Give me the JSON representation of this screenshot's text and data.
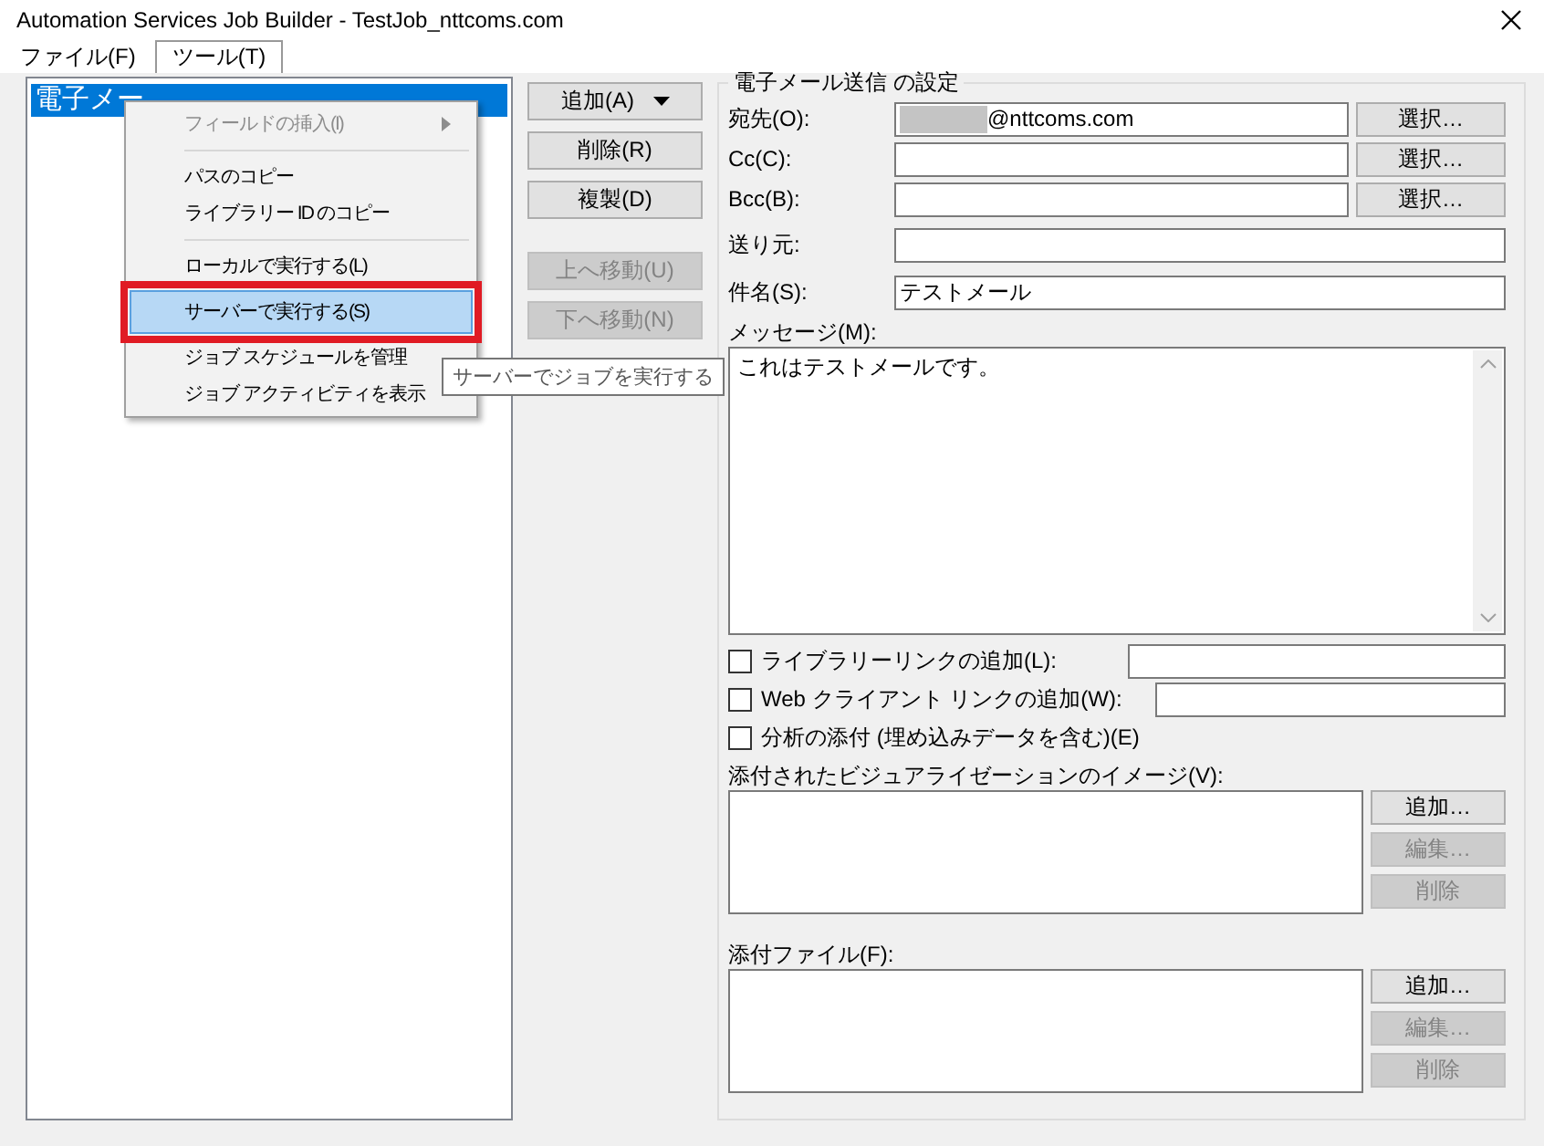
{
  "window": {
    "title": "Automation Services Job Builder - TestJob_nttcoms.com"
  },
  "menubar": [
    {
      "label": "ファイル(F)",
      "selected": false
    },
    {
      "label": "ツール(T)",
      "selected": true
    }
  ],
  "job_list": {
    "items": [
      {
        "label": "電子メー",
        "selected": true
      }
    ]
  },
  "tools_menu": {
    "items": [
      {
        "kind": "submenu",
        "label": "フィールドの挿入(I)",
        "disabled": true,
        "selected": false,
        "callout": false
      },
      {
        "kind": "separator"
      },
      {
        "kind": "item",
        "label": "パスのコピー",
        "disabled": false,
        "selected": false,
        "callout": false
      },
      {
        "kind": "item",
        "label": "ライブラリー ID のコピー",
        "disabled": false,
        "selected": false,
        "callout": false
      },
      {
        "kind": "separator"
      },
      {
        "kind": "item",
        "label": "ローカルで実行する(L)",
        "disabled": false,
        "selected": false,
        "callout": false
      },
      {
        "kind": "item",
        "label": "サーバーで実行する(S)",
        "disabled": false,
        "selected": true,
        "callout": true
      },
      {
        "kind": "item",
        "label": "ジョブ スケジュールを管理",
        "disabled": false,
        "selected": false,
        "callout": false
      },
      {
        "kind": "item",
        "label": "ジョブ アクティビティを表示",
        "disabled": false,
        "selected": false,
        "callout": false
      }
    ]
  },
  "tooltip": "サーバーでジョブを実行する",
  "action_buttons": [
    {
      "kind": "dropdown",
      "label": "追加(A)",
      "disabled": false
    },
    {
      "kind": "plain",
      "label": "削除(R)",
      "disabled": false
    },
    {
      "kind": "plain",
      "label": "複製(D)",
      "disabled": false
    },
    {
      "kind": "spacer"
    },
    {
      "kind": "plain",
      "label": "上へ移動(U)",
      "disabled": true
    },
    {
      "kind": "plain",
      "label": "下へ移動(N)",
      "disabled": true
    }
  ],
  "settings": {
    "title": "電子メール送信 の設定",
    "fields": [
      {
        "label": "宛先(O):",
        "value": "@nttcoms.com",
        "redacted": true,
        "button": "選択…"
      },
      {
        "label": "Cc(C):",
        "redacted": false,
        "button": "選択…"
      },
      {
        "label": "Bcc(B):",
        "redacted": false,
        "button": "選択…"
      },
      {
        "label": "送り元:",
        "redacted": false
      },
      {
        "label": "件名(S):",
        "value": "テストメール",
        "redacted": false
      }
    ],
    "message": {
      "label": "メッセージ(M):",
      "value": "これはテストメールです。"
    },
    "options": [
      {
        "kind": "checkbox-field",
        "label": "ライブラリーリンクの追加(L):",
        "checked": false
      },
      {
        "kind": "checkbox-field",
        "label": "Web クライアント リンクの追加(W):",
        "checked": false
      },
      {
        "kind": "checkbox",
        "label": "分析の添付 (埋め込みデータを含む)(E)",
        "checked": false
      }
    ],
    "lists": [
      {
        "label": "添付されたビジュアライゼーションのイメージ(V):",
        "buttons": [
          {
            "label": "追加…",
            "disabled": false
          },
          {
            "label": "編集…",
            "disabled": true
          },
          {
            "label": "削除",
            "disabled": true
          }
        ]
      },
      {
        "label": "添付ファイル(F):",
        "buttons": [
          {
            "label": "追加…",
            "disabled": false
          },
          {
            "label": "編集…",
            "disabled": true
          },
          {
            "label": "削除",
            "disabled": true
          }
        ]
      }
    ]
  }
}
